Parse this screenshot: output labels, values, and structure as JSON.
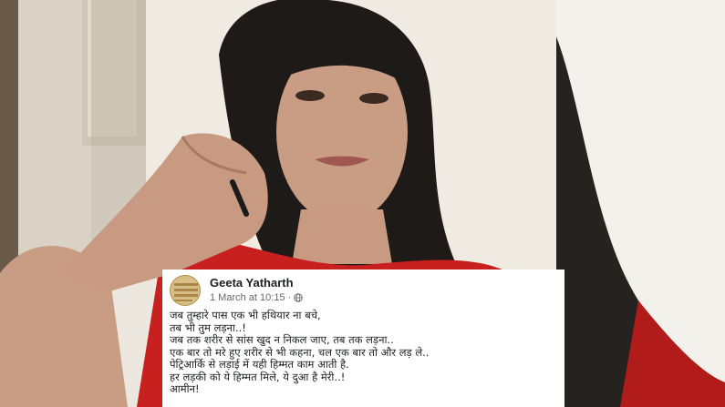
{
  "post": {
    "author": "Geeta Yatharth",
    "timestamp": "1 March at 10:15",
    "separator": "·",
    "privacy_icon": "globe-icon",
    "lines": [
      "जब तुम्हारे पास एक भी हथियार ना बचे,",
      "तब भी तुम लड़ना..!",
      "जब तक शरीर से सांस खुद न निकल जाए, तब तक लड़ना..",
      "एक बार तो मरे हुए शरीर से भी कहना, चल एक बार तो और लड़ ले..",
      "पेट्रिआर्कि से लड़ाई में यही हिम्मत काम आती है.",
      "हर लड़की को ये हिम्मत मिले, ये दुआ है मेरी..!",
      "आमीन!"
    ]
  },
  "colors": {
    "card_bg": "#ffffff",
    "author_text": "#1c1e21",
    "meta_text": "#65676b",
    "dress_red": "#c8201f"
  }
}
